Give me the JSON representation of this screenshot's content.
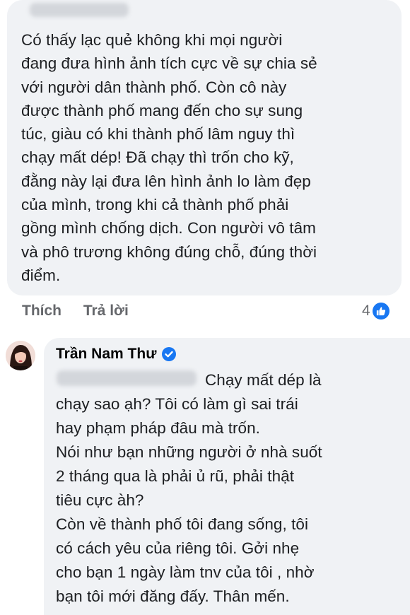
{
  "comment1": {
    "lines": [
      "Có thấy lạc quẻ không khi mọi người",
      "đang đưa hình ảnh tích cực về sự chia sẻ",
      "với người dân thành phố. Còn cô này",
      "được thành phố mang đến cho sự sung",
      "túc, giàu có khi thành phố lâm nguy thì",
      "chạy mất dép! Đã chạy thì trốn cho kỹ,",
      "đằng này lại đưa lên hình ảnh lo làm đẹp",
      "của mình, trong  khi cả thành phố phải",
      "gồng mình chống dịch. Con người vô tâm",
      "và phô trương không đúng chỗ, đúng thời",
      "điểm."
    ],
    "actions": {
      "like": "Thích",
      "reply": "Trả lời"
    },
    "reaction_count": "4"
  },
  "comment2": {
    "author": "Trần Nam Thư",
    "lines": [
      "Chạy mất dép là",
      "chạy sao ạh? Tôi có làm gì sai trái",
      "hay phạm pháp đâu mà trốn.",
      "Nói như bạn những người ở nhà suốt",
      "2 tháng qua là phải ủ rũ, phải thật",
      "tiêu cực àh?",
      "Còn về thành phố tôi đang sống, tôi",
      "có cách yêu của riêng tôi. Gởi nhẹ",
      "cho bạn 1 ngày làm tnv của tôi , nhờ",
      "bạn tôi mới đăng đấy. Thân mến."
    ]
  },
  "icons": {
    "like_badge": "thumbs-up-icon",
    "verified": "verified-check-icon"
  },
  "colors": {
    "bubble": "#f0f2f5",
    "brand": "#1877f2",
    "muted": "#65676b"
  }
}
